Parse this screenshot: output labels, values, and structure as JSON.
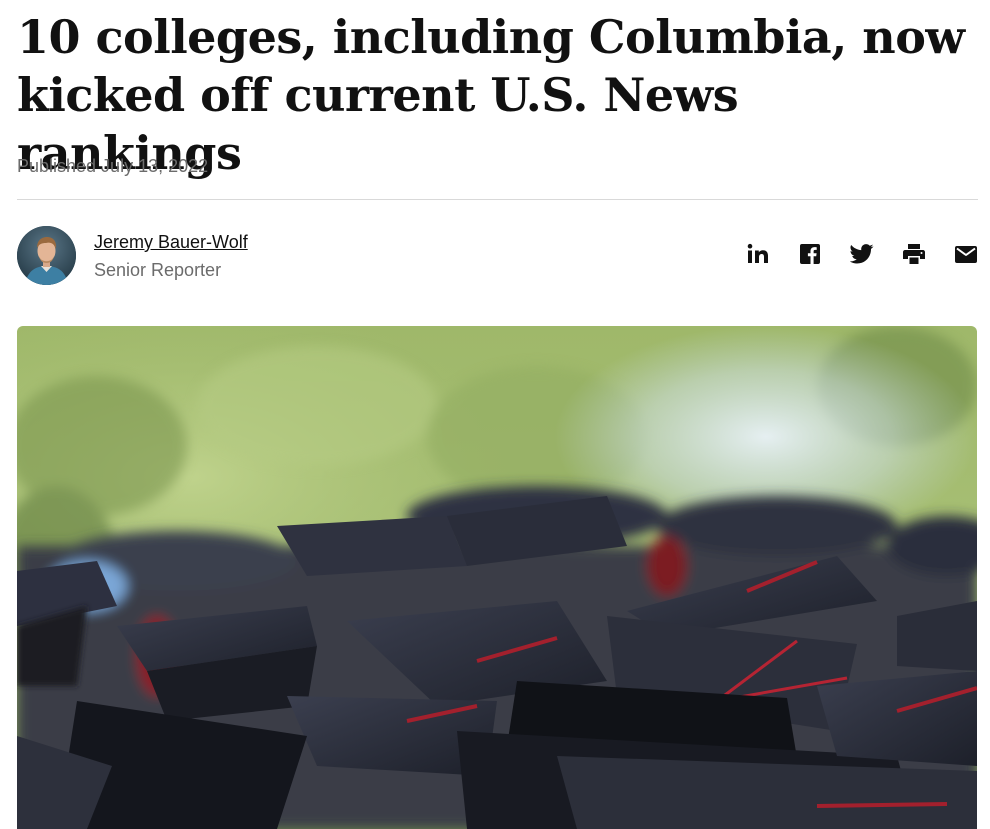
{
  "article": {
    "headline": "10 colleges, including Columbia, now kicked off current U.S. News rankings",
    "published": "Published July 13, 2022"
  },
  "author": {
    "name": "Jeremy Bauer-Wolf",
    "role": "Senior Reporter"
  },
  "share": {
    "icons": [
      "linkedin-icon",
      "facebook-icon",
      "twitter-icon",
      "print-icon",
      "email-icon"
    ]
  },
  "colors": {
    "text": "#111111",
    "muted": "#6b6b6b",
    "divider": "#d9d9d9"
  }
}
